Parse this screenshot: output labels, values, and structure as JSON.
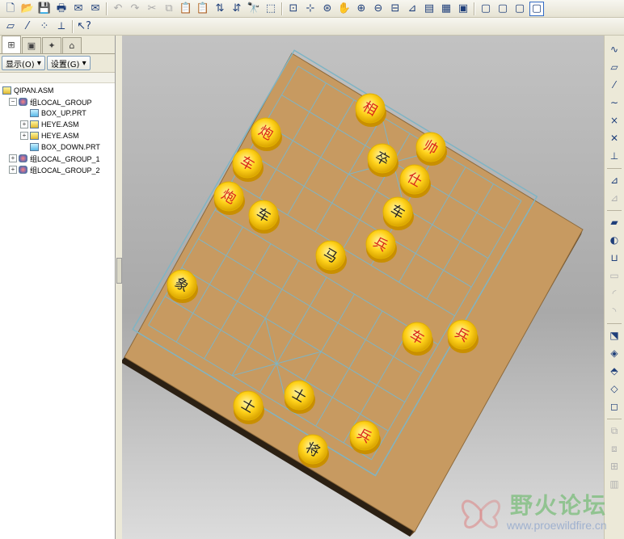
{
  "toolbar1": [
    {
      "name": "new-icon",
      "glyph": "🗋"
    },
    {
      "name": "open-icon",
      "glyph": "📂"
    },
    {
      "name": "save-icon",
      "glyph": "💾"
    },
    {
      "name": "print-icon",
      "glyph": "🖶"
    },
    {
      "name": "mail-icon",
      "glyph": "✉"
    },
    {
      "name": "mail-attach-icon",
      "glyph": "✉"
    },
    {
      "sep": true
    },
    {
      "name": "undo-icon",
      "glyph": "↶",
      "disabled": true
    },
    {
      "name": "redo-icon",
      "glyph": "↷",
      "disabled": true
    },
    {
      "name": "cut-icon",
      "glyph": "✂",
      "disabled": true
    },
    {
      "name": "copy-icon",
      "glyph": "⧉",
      "disabled": true
    },
    {
      "name": "paste-icon",
      "glyph": "📋",
      "disabled": true
    },
    {
      "name": "paste-special-icon",
      "glyph": "📋",
      "disabled": true
    },
    {
      "name": "regenerate-icon",
      "glyph": "⇅"
    },
    {
      "name": "regen-manager-icon",
      "glyph": "⇵"
    },
    {
      "name": "find-icon",
      "glyph": "🔭"
    },
    {
      "name": "select-box-icon",
      "glyph": "⬚"
    },
    {
      "sep": true
    },
    {
      "name": "redraw-icon",
      "glyph": "⊡"
    },
    {
      "name": "spin-center-icon",
      "glyph": "⊹"
    },
    {
      "name": "orient-mode-icon",
      "glyph": "⊛"
    },
    {
      "name": "pan-icon",
      "glyph": "✋"
    },
    {
      "name": "zoom-in-icon",
      "glyph": "⊕"
    },
    {
      "name": "zoom-out-icon",
      "glyph": "⊖"
    },
    {
      "name": "refit-icon",
      "glyph": "⊟"
    },
    {
      "name": "reorient-icon",
      "glyph": "⊿"
    },
    {
      "name": "saved-views-icon",
      "glyph": "▤"
    },
    {
      "name": "layers-icon",
      "glyph": "▦"
    },
    {
      "name": "view-manager-icon",
      "glyph": "▣"
    },
    {
      "sep": true
    },
    {
      "name": "wireframe-icon",
      "glyph": "▢"
    },
    {
      "name": "hidden-line-icon",
      "glyph": "▢"
    },
    {
      "name": "no-hidden-icon",
      "glyph": "▢"
    },
    {
      "name": "shading-icon",
      "glyph": "▢",
      "active": true
    }
  ],
  "toolbar2": [
    {
      "name": "datum-plane-toggle-icon",
      "glyph": "▱"
    },
    {
      "name": "datum-axis-toggle-icon",
      "glyph": "⁄"
    },
    {
      "name": "datum-point-toggle-icon",
      "glyph": "⁘"
    },
    {
      "name": "csys-toggle-icon",
      "glyph": "⟂"
    },
    {
      "sep": true
    },
    {
      "name": "context-help-icon",
      "glyph": "↖?"
    }
  ],
  "left_panel": {
    "tabs": [
      {
        "name": "tab-model-tree-icon",
        "glyph": "⊞",
        "active": true
      },
      {
        "name": "tab-folder-icon",
        "glyph": "▣"
      },
      {
        "name": "tab-favorites-icon",
        "glyph": "✦"
      },
      {
        "name": "tab-connections-icon",
        "glyph": "⌂"
      }
    ],
    "show_menu": "显示(O)",
    "settings_menu": "设置(G)",
    "tree": [
      {
        "label": "QIPAN.ASM",
        "indent": 0,
        "icon": "asm",
        "expander": ""
      },
      {
        "label": "组LOCAL_GROUP",
        "indent": 1,
        "icon": "grp",
        "expander": "−"
      },
      {
        "label": "BOX_UP.PRT",
        "indent": 2,
        "icon": "prt",
        "expander": ""
      },
      {
        "label": "HEYE.ASM",
        "indent": 2,
        "icon": "asm",
        "expander": "+"
      },
      {
        "label": "HEYE.ASM",
        "indent": 2,
        "icon": "asm",
        "expander": "+"
      },
      {
        "label": "BOX_DOWN.PRT",
        "indent": 2,
        "icon": "prt",
        "expander": ""
      },
      {
        "label": "组LOCAL_GROUP_1",
        "indent": 1,
        "icon": "grp",
        "expander": "+"
      },
      {
        "label": "组LOCAL_GROUP_2",
        "indent": 1,
        "icon": "grp",
        "expander": "+"
      }
    ]
  },
  "pieces": [
    {
      "char": "相",
      "color": "red"
    },
    {
      "char": "炮",
      "color": "red"
    },
    {
      "char": "帅",
      "color": "red"
    },
    {
      "char": "卒",
      "color": "black"
    },
    {
      "char": "车",
      "color": "red"
    },
    {
      "char": "仕",
      "color": "red"
    },
    {
      "char": "炮",
      "color": "red"
    },
    {
      "char": "车",
      "color": "black"
    },
    {
      "char": "车",
      "color": "black"
    },
    {
      "char": "兵",
      "color": "red"
    },
    {
      "char": "马",
      "color": "black"
    },
    {
      "char": "象",
      "color": "black"
    },
    {
      "char": "车",
      "color": "red"
    },
    {
      "char": "兵",
      "color": "red"
    },
    {
      "char": "士",
      "color": "black"
    },
    {
      "char": "士",
      "color": "black"
    },
    {
      "char": "兵",
      "color": "red"
    },
    {
      "char": "将",
      "color": "black"
    }
  ],
  "right_toolbar": [
    {
      "name": "sketch-curve-icon",
      "glyph": "∿"
    },
    {
      "name": "datum-plane-icon",
      "glyph": "▱"
    },
    {
      "name": "datum-axis-icon",
      "glyph": "⁄"
    },
    {
      "name": "datum-curve-icon",
      "glyph": "∼"
    },
    {
      "name": "datum-point-icon",
      "glyph": "×"
    },
    {
      "name": "datum-point-offset-icon",
      "glyph": "✕"
    },
    {
      "name": "csys-icon",
      "glyph": "⊥"
    },
    {
      "sep": true
    },
    {
      "name": "component-place-icon",
      "glyph": "⊿"
    },
    {
      "name": "component-create-icon",
      "glyph": "⊿",
      "disabled": true
    },
    {
      "sep": true
    },
    {
      "name": "extrude-icon",
      "glyph": "▰"
    },
    {
      "name": "revolve-icon",
      "glyph": "◐"
    },
    {
      "name": "hole-icon",
      "glyph": "⊔"
    },
    {
      "name": "shell-icon",
      "glyph": "▭",
      "disabled": true
    },
    {
      "name": "rib-icon",
      "glyph": "◜",
      "disabled": true
    },
    {
      "name": "draft-icon",
      "glyph": "◝",
      "disabled": true
    },
    {
      "sep": true
    },
    {
      "name": "round-icon",
      "glyph": "⬔"
    },
    {
      "name": "chamfer-icon",
      "glyph": "◈"
    },
    {
      "name": "pattern-icon",
      "glyph": "⬘"
    },
    {
      "name": "mirror-icon",
      "glyph": "◇"
    },
    {
      "name": "trim-icon",
      "glyph": "◻"
    },
    {
      "sep": true
    },
    {
      "name": "merge-icon",
      "glyph": "⧉",
      "disabled": true
    },
    {
      "name": "intersect-icon",
      "glyph": "⧈",
      "disabled": true
    },
    {
      "name": "offset-icon",
      "glyph": "⊞",
      "disabled": true
    },
    {
      "name": "thicken-icon",
      "glyph": "▥",
      "disabled": true
    }
  ],
  "watermark": {
    "text": "野火论坛",
    "url": "www.proewildfire.cn"
  }
}
